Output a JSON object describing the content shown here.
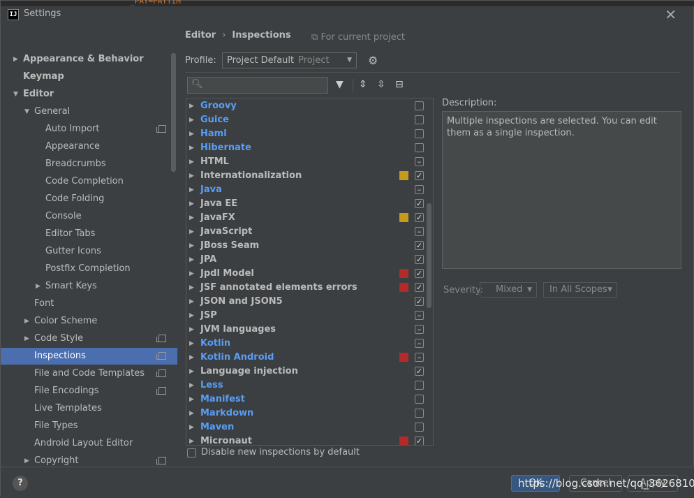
{
  "window": {
    "title": "Settings",
    "app_icon_text": "IJ",
    "close": "✕",
    "editor_fragment": "_PAY=PAYTIM"
  },
  "sidebar": {
    "search_placeholder": "",
    "items": [
      {
        "label": "Appearance & Behavior",
        "level": 0,
        "arrow": "right",
        "bold": true,
        "copy": false,
        "selected": false
      },
      {
        "label": "Keymap",
        "level": 0,
        "arrow": "none",
        "bold": true,
        "copy": false,
        "selected": false
      },
      {
        "label": "Editor",
        "level": 0,
        "arrow": "down",
        "bold": true,
        "copy": false,
        "selected": false
      },
      {
        "label": "General",
        "level": 1,
        "arrow": "down",
        "bold": false,
        "copy": false,
        "selected": false
      },
      {
        "label": "Auto Import",
        "level": 2,
        "arrow": "none",
        "bold": false,
        "copy": true,
        "selected": false
      },
      {
        "label": "Appearance",
        "level": 2,
        "arrow": "none",
        "bold": false,
        "copy": false,
        "selected": false
      },
      {
        "label": "Breadcrumbs",
        "level": 2,
        "arrow": "none",
        "bold": false,
        "copy": false,
        "selected": false
      },
      {
        "label": "Code Completion",
        "level": 2,
        "arrow": "none",
        "bold": false,
        "copy": false,
        "selected": false
      },
      {
        "label": "Code Folding",
        "level": 2,
        "arrow": "none",
        "bold": false,
        "copy": false,
        "selected": false
      },
      {
        "label": "Console",
        "level": 2,
        "arrow": "none",
        "bold": false,
        "copy": false,
        "selected": false
      },
      {
        "label": "Editor Tabs",
        "level": 2,
        "arrow": "none",
        "bold": false,
        "copy": false,
        "selected": false
      },
      {
        "label": "Gutter Icons",
        "level": 2,
        "arrow": "none",
        "bold": false,
        "copy": false,
        "selected": false
      },
      {
        "label": "Postfix Completion",
        "level": 2,
        "arrow": "none",
        "bold": false,
        "copy": false,
        "selected": false
      },
      {
        "label": "Smart Keys",
        "level": 2,
        "arrow": "right",
        "bold": false,
        "copy": false,
        "selected": false
      },
      {
        "label": "Font",
        "level": 1,
        "arrow": "none",
        "bold": false,
        "copy": false,
        "selected": false
      },
      {
        "label": "Color Scheme",
        "level": 1,
        "arrow": "right",
        "bold": false,
        "copy": false,
        "selected": false
      },
      {
        "label": "Code Style",
        "level": 1,
        "arrow": "right",
        "bold": false,
        "copy": true,
        "selected": false
      },
      {
        "label": "Inspections",
        "level": 1,
        "arrow": "none",
        "bold": false,
        "copy": true,
        "selected": true
      },
      {
        "label": "File and Code Templates",
        "level": 1,
        "arrow": "none",
        "bold": false,
        "copy": true,
        "selected": false
      },
      {
        "label": "File Encodings",
        "level": 1,
        "arrow": "none",
        "bold": false,
        "copy": true,
        "selected": false
      },
      {
        "label": "Live Templates",
        "level": 1,
        "arrow": "none",
        "bold": false,
        "copy": false,
        "selected": false
      },
      {
        "label": "File Types",
        "level": 1,
        "arrow": "none",
        "bold": false,
        "copy": false,
        "selected": false
      },
      {
        "label": "Android Layout Editor",
        "level": 1,
        "arrow": "none",
        "bold": false,
        "copy": false,
        "selected": false
      },
      {
        "label": "Copyright",
        "level": 1,
        "arrow": "right",
        "bold": false,
        "copy": true,
        "selected": false
      }
    ]
  },
  "breadcrumb": {
    "parent": "Editor",
    "separator": "›",
    "current": "Inspections"
  },
  "for_current_project": "For current project",
  "profile": {
    "label": "Profile:",
    "value": "Project Default",
    "sub": "Project"
  },
  "filter": {
    "placeholder": ""
  },
  "inspections": [
    {
      "name": "Groovy",
      "blue": true,
      "severity": "none",
      "check": "empty"
    },
    {
      "name": "Guice",
      "blue": true,
      "severity": "none",
      "check": "empty"
    },
    {
      "name": "Haml",
      "blue": true,
      "severity": "none",
      "check": "empty"
    },
    {
      "name": "Hibernate",
      "blue": true,
      "severity": "none",
      "check": "empty"
    },
    {
      "name": "HTML",
      "blue": false,
      "severity": "none",
      "check": "partial"
    },
    {
      "name": "Internationalization",
      "blue": false,
      "severity": "#c69a1c",
      "check": "checked"
    },
    {
      "name": "Java",
      "blue": true,
      "severity": "none",
      "check": "partial"
    },
    {
      "name": "Java EE",
      "blue": false,
      "severity": "none",
      "check": "checked"
    },
    {
      "name": "JavaFX",
      "blue": false,
      "severity": "#c69a1c",
      "check": "checked"
    },
    {
      "name": "JavaScript",
      "blue": false,
      "severity": "none",
      "check": "partial"
    },
    {
      "name": "JBoss Seam",
      "blue": false,
      "severity": "none",
      "check": "checked"
    },
    {
      "name": "JPA",
      "blue": false,
      "severity": "none",
      "check": "checked"
    },
    {
      "name": "Jpdl Model",
      "blue": false,
      "severity": "#b22a2a",
      "check": "checked"
    },
    {
      "name": "JSF annotated elements errors",
      "blue": false,
      "severity": "#b22a2a",
      "check": "checked"
    },
    {
      "name": "JSON and JSON5",
      "blue": false,
      "severity": "none",
      "check": "checked"
    },
    {
      "name": "JSP",
      "blue": false,
      "severity": "none",
      "check": "partial"
    },
    {
      "name": "JVM languages",
      "blue": false,
      "severity": "none",
      "check": "partial"
    },
    {
      "name": "Kotlin",
      "blue": true,
      "severity": "none",
      "check": "partial"
    },
    {
      "name": "Kotlin Android",
      "blue": true,
      "severity": "#b22a2a",
      "check": "partial"
    },
    {
      "name": "Language injection",
      "blue": false,
      "severity": "none",
      "check": "checked"
    },
    {
      "name": "Less",
      "blue": true,
      "severity": "none",
      "check": "empty"
    },
    {
      "name": "Manifest",
      "blue": true,
      "severity": "none",
      "check": "empty"
    },
    {
      "name": "Markdown",
      "blue": true,
      "severity": "none",
      "check": "empty"
    },
    {
      "name": "Maven",
      "blue": true,
      "severity": "none",
      "check": "empty"
    },
    {
      "name": "Micronaut",
      "blue": false,
      "severity": "#b22a2a",
      "check": "checked"
    }
  ],
  "disable_new_label": "Disable new inspections by default",
  "description": {
    "label": "Description:",
    "text": "Multiple inspections are selected. You can edit them as a single inspection."
  },
  "severity": {
    "label": "Severity:",
    "value": "Mixed",
    "scope": "In All Scopes"
  },
  "footer": {
    "help": "?",
    "ok": "OK",
    "cancel": "Cancel",
    "apply": "Apply",
    "watermark": "https://blog.csdn.net/qq_36268103"
  }
}
